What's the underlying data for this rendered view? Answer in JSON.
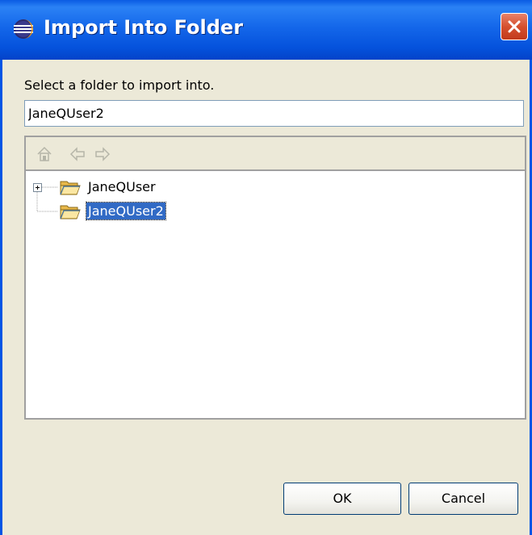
{
  "window": {
    "title": "Import Into Folder"
  },
  "prompt": "Select a folder to import into.",
  "folder_input": {
    "value": "JaneQUser2"
  },
  "toolbar": {
    "icons": [
      "home-icon",
      "back-arrow-icon",
      "forward-arrow-icon"
    ]
  },
  "tree": {
    "items": [
      {
        "label": "JaneQUser",
        "expandable": true,
        "selected": false
      },
      {
        "label": "JaneQUser2",
        "expandable": false,
        "selected": true
      }
    ]
  },
  "buttons": {
    "ok": "OK",
    "cancel": "Cancel"
  },
  "colors": {
    "titlebar": "#0552dc",
    "selection": "#316ac5",
    "dialog_bg": "#ece9d8",
    "close_button": "#d6502e"
  }
}
